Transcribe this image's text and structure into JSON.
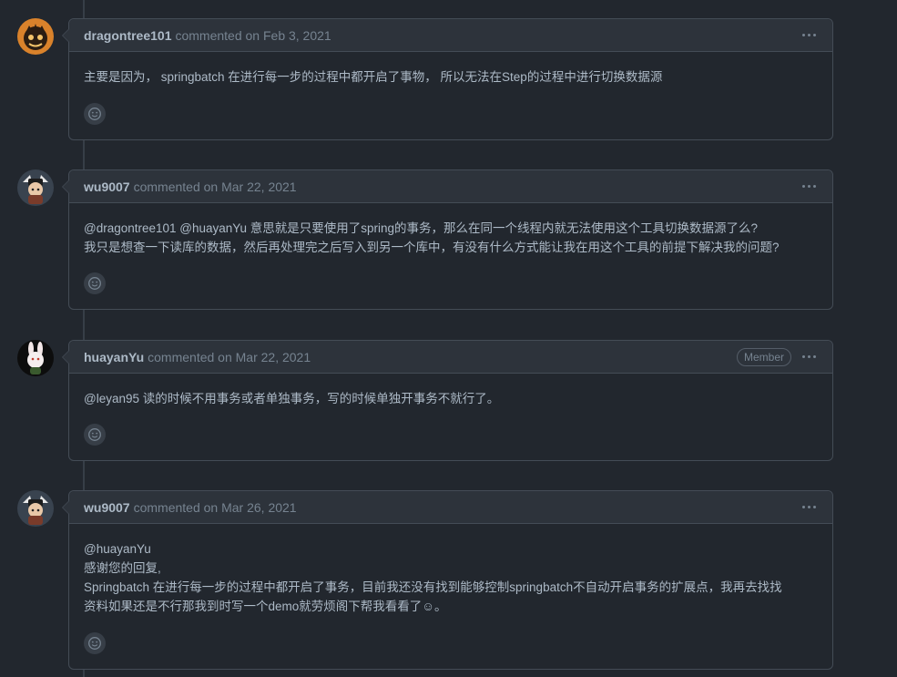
{
  "comments": [
    {
      "author": "dragontree101",
      "meta": "commented on Feb 3, 2021",
      "badge": "",
      "lines": [
        "主要是因为， springbatch 在进行每一步的过程中都开启了事物， 所以无法在Step的过程中进行切换数据源"
      ]
    },
    {
      "author": "wu9007",
      "meta": "commented on Mar 22, 2021",
      "badge": "",
      "lines": [
        "@dragontree101 @huayanYu 意思就是只要使用了spring的事务，那么在同一个线程内就无法使用这个工具切换数据源了么?",
        "我只是想查一下读库的数据，然后再处理完之后写入到另一个库中，有没有什么方式能让我在用这个工具的前提下解决我的问题?"
      ]
    },
    {
      "author": "huayanYu",
      "meta": "commented on Mar 22, 2021",
      "badge": "Member",
      "lines": [
        "@leyan95 读的时候不用事务或者单独事务，写的时候单独开事务不就行了。"
      ]
    },
    {
      "author": "wu9007",
      "meta": "commented on Mar 26, 2021",
      "badge": "",
      "lines": [
        "@huayanYu",
        "感谢您的回复,",
        "Springbatch 在进行每一步的过程中都开启了事务，目前我还没有找到能够控制springbatch不自动开启事务的扩展点，我再去找找",
        "资料如果还是不行那我到时写一个demo就劳烦阁下帮我看看了☺。"
      ]
    }
  ],
  "icons": {
    "more": "kebab-horizontal-icon",
    "reaction": "smiley-icon"
  },
  "colors": {
    "background": "#22272e",
    "header_bg": "#2d333b",
    "border": "#444c56",
    "text": "#adbac7",
    "muted": "#768390"
  }
}
